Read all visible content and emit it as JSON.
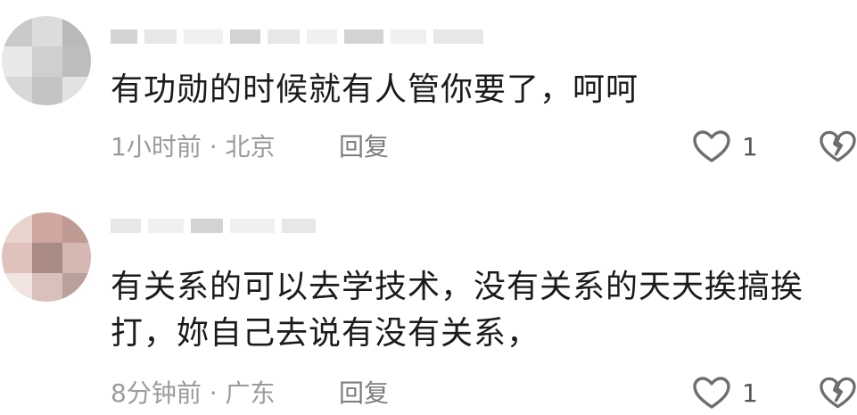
{
  "comments": [
    {
      "content": "有功勋的时候就有人管你要了，呵呵",
      "meta": "1小时前 · 北京",
      "reply_label": "回复",
      "likes": "1",
      "avatar_tones": [
        "#c9c9c9",
        "#dcdcdc",
        "#b9b9b9",
        "#e8e8e8",
        "#cfcfcf",
        "#bdbdbd",
        "#d8d8d8",
        "#c4c4c4",
        "#e2e2e2"
      ]
    },
    {
      "content": "有关系的可以去学技术，没有关系的天天挨搞挨打，妳自己去说有没有关系，",
      "meta": "8分钟前 · 广东",
      "reply_label": "回复",
      "likes": "1",
      "avatar_tones": [
        "#e9d3cf",
        "#cfa7a0",
        "#bf9a93",
        "#e0c2bc",
        "#a98a84",
        "#d6b8b2",
        "#f1e3e0",
        "#d9c0bb",
        "#b9a09a"
      ]
    }
  ],
  "icons": {
    "like": "heart-outline-icon",
    "dislike": "broken-heart-icon"
  }
}
